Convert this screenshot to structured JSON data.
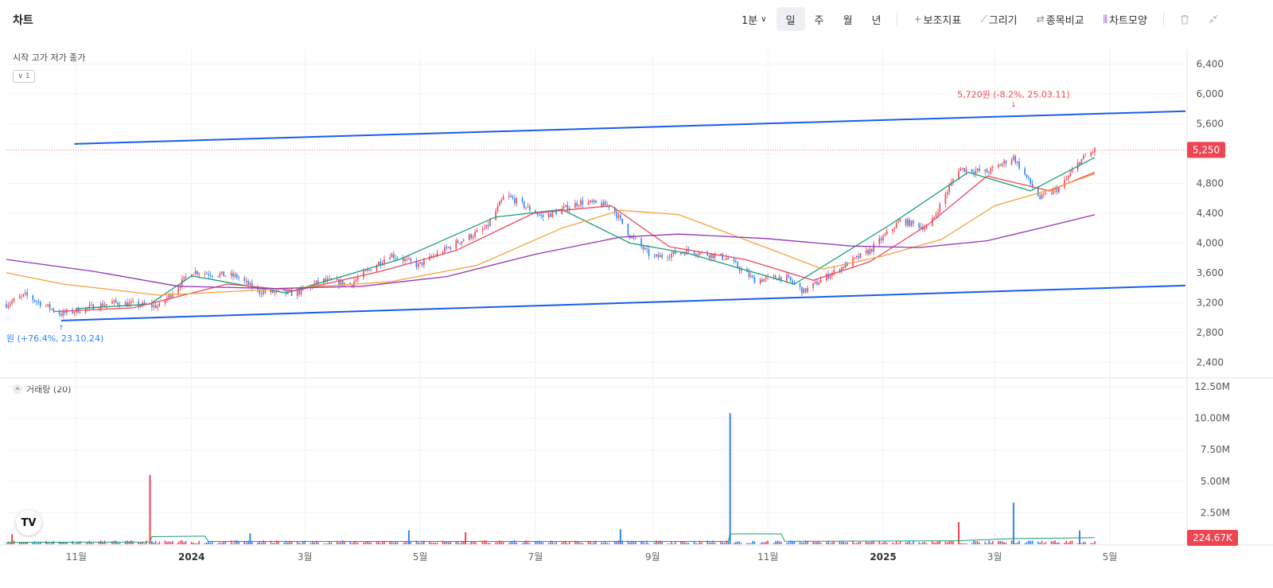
{
  "header": {
    "title": "차트",
    "timeframe": "1분",
    "periods": [
      "일",
      "주",
      "월",
      "년"
    ],
    "active_period": "일",
    "tools": [
      {
        "icon": "plus-icon",
        "glyph": "+",
        "label": "보조지표"
      },
      {
        "icon": "pencil-icon",
        "glyph": "⟋",
        "label": "그리기"
      },
      {
        "icon": "compare-icon",
        "glyph": "⇄",
        "label": "종목비교"
      },
      {
        "icon": "candle-icon",
        "glyph": "⫼",
        "label": "차트모양"
      }
    ]
  },
  "legend": {
    "ohlc_label": "시작 고가 저가 종가",
    "ma_toggle": "1",
    "volume_label": "거래량 (20)"
  },
  "colors": {
    "up": "#f04452",
    "down": "#3182f6",
    "trend": "#1a5cf0",
    "ma_short": "#1b9e77",
    "ma_mid": "#e94b60",
    "ma_long": "#f5a13a",
    "ma_xlong": "#9333b8"
  },
  "chart_data": [
    {
      "type": "line",
      "y_axis": {
        "min": 2200,
        "max": 6600,
        "ticks": [
          2400,
          2800,
          3200,
          3600,
          4000,
          4400,
          4800,
          5200,
          5600,
          6000,
          6400
        ]
      },
      "x_axis": {
        "range": [
          "2023-09-25",
          "2025-06-10"
        ],
        "ticks": [
          [
            "2023-11-01",
            "11월"
          ],
          [
            "2024-01-01",
            "2024"
          ],
          [
            "2024-03-01",
            "3월"
          ],
          [
            "2024-05-01",
            "5월"
          ],
          [
            "2024-07-01",
            "7월"
          ],
          [
            "2024-09-01",
            "9월"
          ],
          [
            "2024-11-01",
            "11월"
          ],
          [
            "2025-01-01",
            "2025"
          ],
          [
            "2025-03-01",
            "3월"
          ],
          [
            "2025-05-01",
            "5월"
          ]
        ]
      },
      "grid": true,
      "price_points": [
        [
          "2023-09-25",
          3180
        ],
        [
          "2023-10-05",
          3300
        ],
        [
          "2023-10-24",
          3050
        ],
        [
          "2023-11-20",
          3200
        ],
        [
          "2023-12-15",
          3150
        ],
        [
          "2024-01-01",
          3620
        ],
        [
          "2024-01-25",
          3550
        ],
        [
          "2024-02-05",
          3350
        ],
        [
          "2024-02-25",
          3320
        ],
        [
          "2024-03-10",
          3500
        ],
        [
          "2024-03-25",
          3450
        ],
        [
          "2024-04-15",
          3850
        ],
        [
          "2024-04-30",
          3700
        ],
        [
          "2024-05-20",
          4000
        ],
        [
          "2024-06-05",
          4200
        ],
        [
          "2024-06-15",
          4650
        ],
        [
          "2024-07-05",
          4350
        ],
        [
          "2024-07-25",
          4550
        ],
        [
          "2024-08-10",
          4500
        ],
        [
          "2024-08-20",
          4100
        ],
        [
          "2024-09-01",
          3800
        ],
        [
          "2024-09-20",
          3900
        ],
        [
          "2024-10-10",
          3800
        ],
        [
          "2024-10-25",
          3500
        ],
        [
          "2024-11-10",
          3550
        ],
        [
          "2024-11-20",
          3350
        ],
        [
          "2024-12-05",
          3600
        ],
        [
          "2024-12-25",
          3900
        ],
        [
          "2025-01-10",
          4300
        ],
        [
          "2025-01-25",
          4200
        ],
        [
          "2025-02-10",
          5000
        ],
        [
          "2025-02-25",
          4950
        ],
        [
          "2025-03-11",
          5150
        ],
        [
          "2025-03-25",
          4600
        ],
        [
          "2025-04-05",
          4750
        ],
        [
          "2025-04-15",
          5100
        ],
        [
          "2025-04-23",
          5250
        ]
      ],
      "series": [
        {
          "key": "ma_short",
          "points": [
            [
              "2023-11-01",
              3120
            ],
            [
              "2023-12-10",
              3180
            ],
            [
              "2024-01-01",
              3560
            ],
            [
              "2024-02-20",
              3330
            ],
            [
              "2024-04-20",
              3780
            ],
            [
              "2024-06-10",
              4350
            ],
            [
              "2024-07-15",
              4450
            ],
            [
              "2024-08-20",
              4000
            ],
            [
              "2024-09-20",
              3860
            ],
            [
              "2024-11-15",
              3450
            ],
            [
              "2025-01-05",
              4250
            ],
            [
              "2025-02-15",
              4950
            ],
            [
              "2025-03-20",
              4700
            ],
            [
              "2025-04-23",
              5150
            ]
          ]
        },
        {
          "key": "ma_mid",
          "points": [
            [
              "2023-10-20",
              3080
            ],
            [
              "2023-12-01",
              3130
            ],
            [
              "2024-01-20",
              3450
            ],
            [
              "2024-02-25",
              3360
            ],
            [
              "2024-04-10",
              3620
            ],
            [
              "2024-05-20",
              3900
            ],
            [
              "2024-06-30",
              4400
            ],
            [
              "2024-08-10",
              4500
            ],
            [
              "2024-09-10",
              3950
            ],
            [
              "2024-10-20",
              3780
            ],
            [
              "2024-11-25",
              3500
            ],
            [
              "2024-12-25",
              3750
            ],
            [
              "2025-01-25",
              4250
            ],
            [
              "2025-02-25",
              4900
            ],
            [
              "2025-03-30",
              4700
            ],
            [
              "2025-04-23",
              4950
            ]
          ]
        },
        {
          "key": "ma_long",
          "points": [
            [
              "2023-09-25",
              3600
            ],
            [
              "2023-10-25",
              3450
            ],
            [
              "2023-12-15",
              3300
            ],
            [
              "2024-02-15",
              3380
            ],
            [
              "2024-04-15",
              3480
            ],
            [
              "2024-05-31",
              3700
            ],
            [
              "2024-07-15",
              4200
            ],
            [
              "2024-08-15",
              4440
            ],
            [
              "2024-09-15",
              4380
            ],
            [
              "2024-10-31",
              3940
            ],
            [
              "2024-11-30",
              3650
            ],
            [
              "2024-12-31",
              3820
            ],
            [
              "2025-02-01",
              4050
            ],
            [
              "2025-03-01",
              4500
            ],
            [
              "2025-03-31",
              4720
            ],
            [
              "2025-04-23",
              4930
            ]
          ]
        },
        {
          "key": "ma_xlong",
          "points": [
            [
              "2023-09-25",
              3780
            ],
            [
              "2023-11-10",
              3620
            ],
            [
              "2023-12-25",
              3420
            ],
            [
              "2024-02-15",
              3390
            ],
            [
              "2024-03-31",
              3420
            ],
            [
              "2024-05-15",
              3550
            ],
            [
              "2024-07-01",
              3850
            ],
            [
              "2024-08-15",
              4080
            ],
            [
              "2024-09-15",
              4120
            ],
            [
              "2024-10-31",
              4060
            ],
            [
              "2024-12-15",
              3960
            ],
            [
              "2025-01-20",
              3940
            ],
            [
              "2025-02-25",
              4030
            ],
            [
              "2025-03-25",
              4200
            ],
            [
              "2025-04-23",
              4380
            ]
          ]
        }
      ],
      "trendlines": [
        {
          "from": [
            "2023-10-31",
            5330
          ],
          "to": [
            "2025-06-10",
            5770
          ]
        },
        {
          "from": [
            "2023-10-24",
            2960
          ],
          "to": [
            "2025-06-10",
            3430
          ]
        }
      ],
      "annotations": [
        {
          "date": "2025-03-11",
          "value": 5720,
          "text": "5,720원 (-8.2%, 25.03.11)",
          "color": "up"
        },
        {
          "date": "2023-10-24",
          "value": 2960,
          "text": "원 (+76.4%, 23.10.24)",
          "color": "down"
        }
      ],
      "current_price": {
        "value": 5250,
        "label": "5,250"
      }
    },
    {
      "type": "bar",
      "title": "거래량 (20)",
      "y_axis": {
        "min": 0,
        "max": 12500000,
        "ticks": [
          2500000,
          5000000,
          7500000,
          10000000,
          12500000
        ],
        "tick_labels": [
          "2.50M",
          "5.00M",
          "7.50M",
          "10.00M",
          "12.50M"
        ]
      },
      "spikes": [
        {
          "date": "2023-12-10",
          "value": 5500000,
          "dir": "up"
        },
        {
          "date": "2024-10-12",
          "value": 10400000,
          "dir": "down"
        },
        {
          "date": "2025-03-11",
          "value": 3300000,
          "dir": "down"
        },
        {
          "date": "2025-02-10",
          "value": 1750000,
          "dir": "up"
        },
        {
          "date": "2024-08-15",
          "value": 1200000,
          "dir": "down"
        },
        {
          "date": "2024-04-25",
          "value": 1100000,
          "dir": "down"
        },
        {
          "date": "2024-05-25",
          "value": 950000,
          "dir": "up"
        },
        {
          "date": "2024-02-01",
          "value": 850000,
          "dir": "down"
        },
        {
          "date": "2023-09-28",
          "value": 800000,
          "dir": "up"
        },
        {
          "date": "2025-04-15",
          "value": 1100000,
          "dir": "down"
        }
      ],
      "volume_ma": [
        [
          "2023-09-25",
          150000
        ],
        [
          "2023-12-10",
          170000
        ],
        [
          "2023-12-11",
          600000
        ],
        [
          "2024-01-08",
          640000
        ],
        [
          "2024-01-10",
          220000
        ],
        [
          "2024-10-11",
          220000
        ],
        [
          "2024-10-12",
          820000
        ],
        [
          "2024-11-08",
          820000
        ],
        [
          "2024-11-10",
          230000
        ],
        [
          "2025-02-10",
          280000
        ],
        [
          "2025-03-11",
          450000
        ],
        [
          "2025-04-10",
          500000
        ],
        [
          "2025-04-23",
          520000
        ]
      ],
      "current_volume": {
        "value": 224670,
        "label": "224.67K"
      }
    }
  ]
}
